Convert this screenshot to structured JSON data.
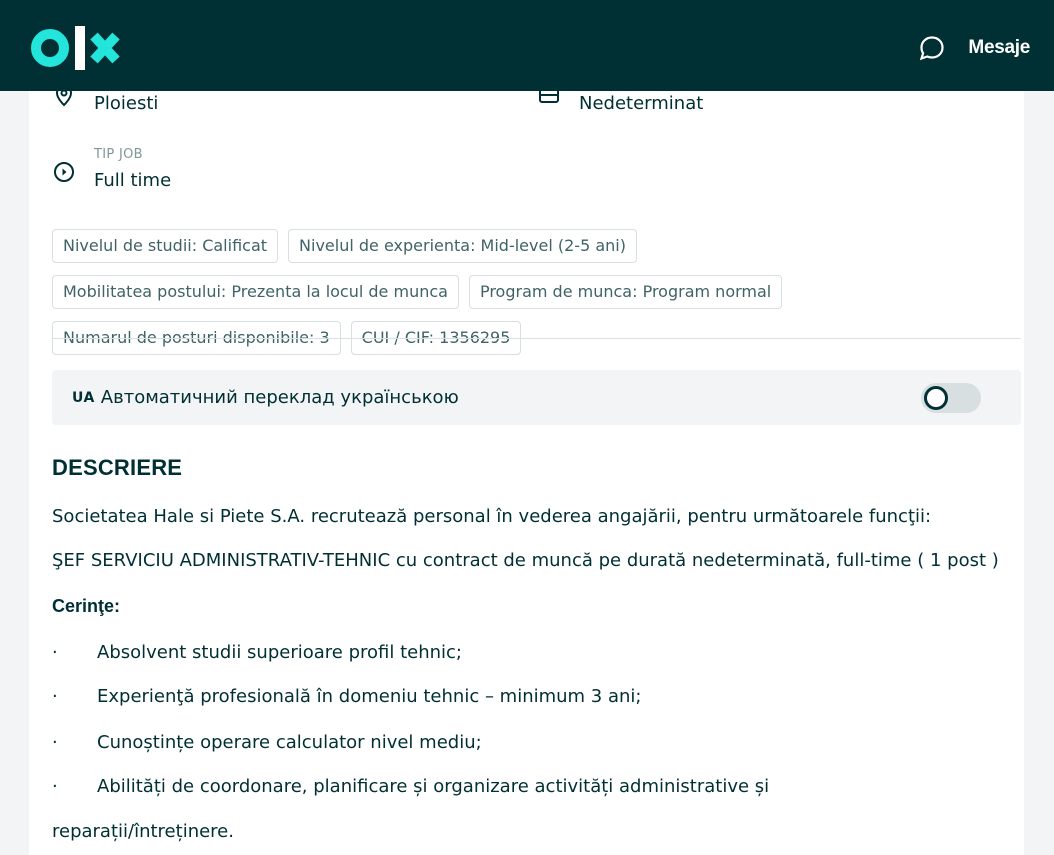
{
  "header": {
    "logo_text": "olx",
    "messages_label": "Mesaje"
  },
  "info": {
    "location_value": "Ploiesti",
    "contract_value": "Nedeterminat",
    "job_type_label": "TIP JOB",
    "job_type_value": "Full time"
  },
  "tags": [
    "Nivelul de studii: Calificat",
    "Nivelul de experienta: Mid-level (2-5 ani)",
    "Mobilitatea postului: Prezenta la locul de munca",
    "Program de munca: Program normal",
    "Numarul de posturi disponibile: 3",
    "CUI / CIF: 1356295"
  ],
  "translation": {
    "lang_code": "UA",
    "label": "Автоматичний переклад українською",
    "enabled": false
  },
  "description": {
    "title": "DESCRIERE",
    "intro": "Societatea Hale si Piete S.A. recrutează personal în vederea angajării, pentru următoarele funcţii:",
    "position": "ŞEF SERVICIU ADMINISTRATIV-TEHNIC cu contract de muncă pe durată nedeterminată, full-time ( 1 post )",
    "requirements_title": "Cerinţe:",
    "bullet_char": "·",
    "requirements": [
      "Absolvent studii superioare profil tehnic;",
      "Experienţă profesională în domeniu tehnic – minimum 3 ani;",
      "Cunoștințe operare calculator nivel mediu;",
      "Abilități de coordonare, planificare și organizare activități administrative și"
    ],
    "continuation": "reparații/întreținere."
  },
  "colors": {
    "brand_dark": "#002f34",
    "brand_accent": "#23e5db",
    "tag_border": "#d8dfe0"
  }
}
